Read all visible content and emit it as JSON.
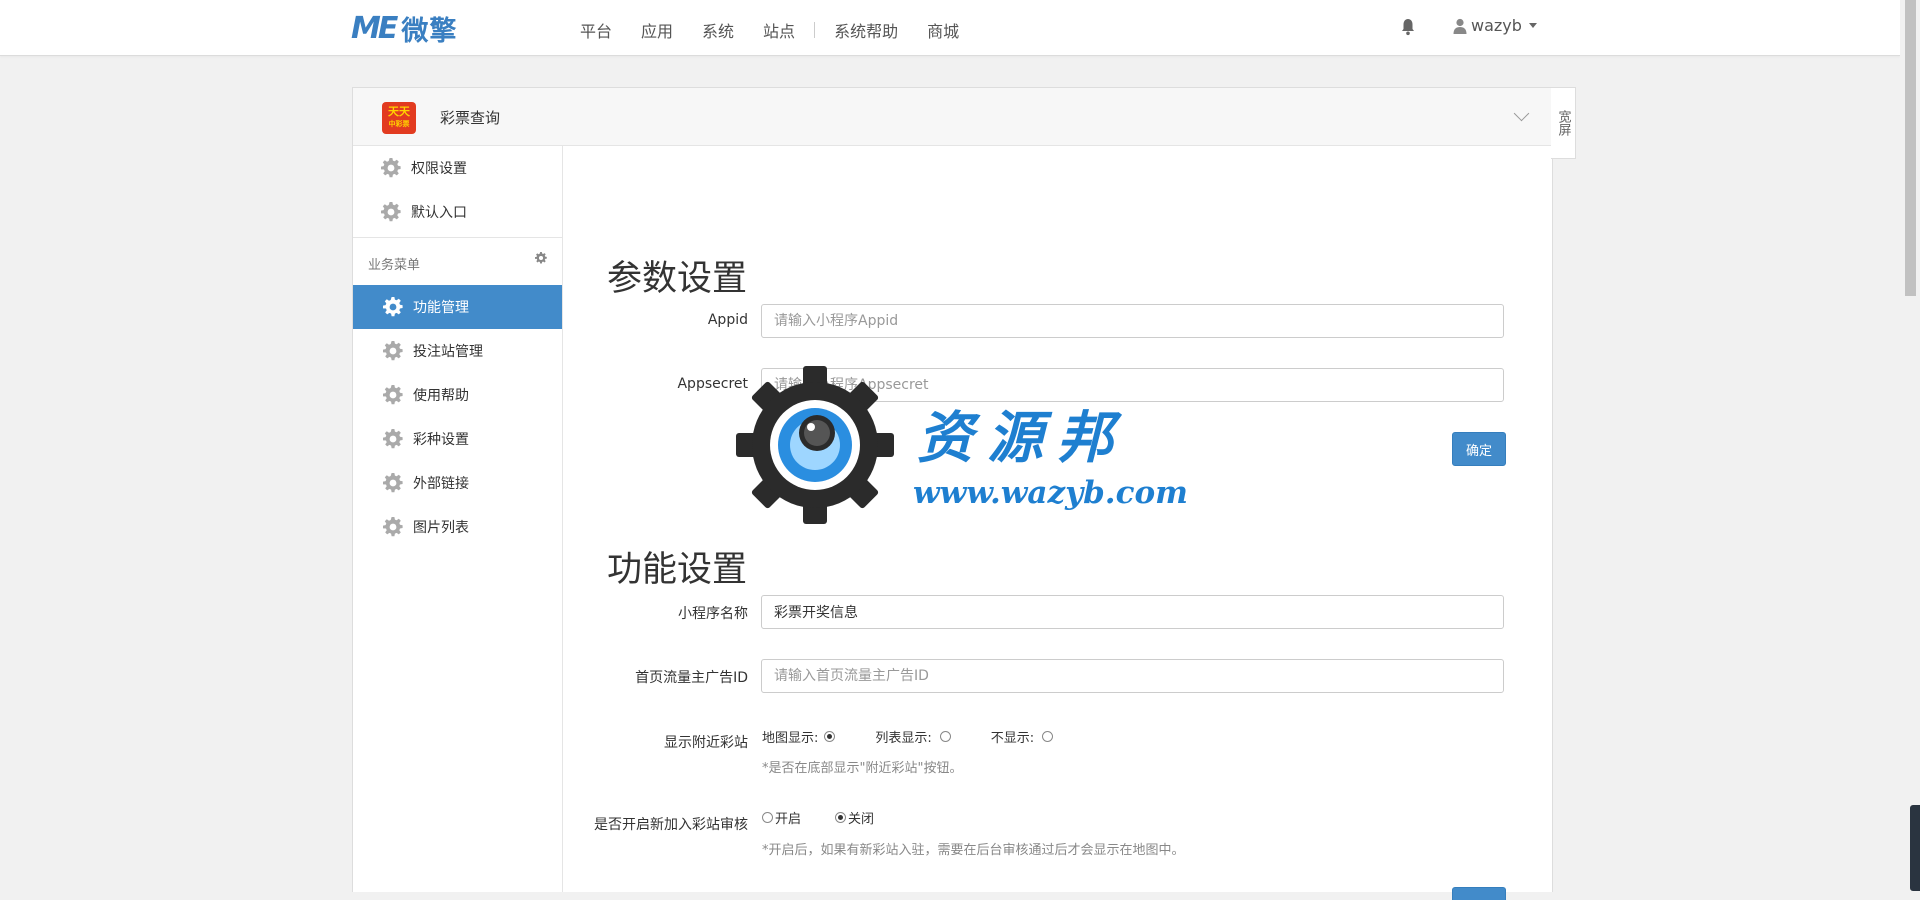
{
  "brand": {
    "logo_mark": "ME",
    "logo_text": "微擎"
  },
  "nav": {
    "items": [
      "平台",
      "应用",
      "系统",
      "站点",
      "系统帮助",
      "商城"
    ]
  },
  "user": {
    "name": "wazyb"
  },
  "app": {
    "title": "彩票查询",
    "icon_text_1": "天天",
    "icon_text_2": "中彩票",
    "widescreen_label": "宽屏"
  },
  "sidebar": {
    "top_items": [
      {
        "label": "权限设置"
      },
      {
        "label": "默认入口"
      }
    ],
    "group_label": "业务菜单",
    "items": [
      {
        "label": "功能管理",
        "active": true
      },
      {
        "label": "投注站管理"
      },
      {
        "label": "使用帮助"
      },
      {
        "label": "彩种设置"
      },
      {
        "label": "外部链接"
      },
      {
        "label": "图片列表"
      }
    ]
  },
  "params": {
    "heading": "参数设置",
    "appid_label": "Appid",
    "appid_placeholder": "请输入小程序Appid",
    "appsecret_label": "Appsecret",
    "appsecret_placeholder": "请输入小程序Appsecret",
    "confirm_label": "确定"
  },
  "features": {
    "heading": "功能设置",
    "name_label": "小程序名称",
    "name_value": "彩票开奖信息",
    "ad_label": "首页流量主广告ID",
    "ad_placeholder": "请输入首页流量主广告ID",
    "nearby_label": "显示附近彩站",
    "nearby_options": [
      "地图显示:",
      "列表显示:",
      "不显示:"
    ],
    "nearby_selected": 0,
    "nearby_help": "*是否在底部显示\"附近彩站\"按钮。",
    "review_label": "是否开启新加入彩站审核",
    "review_options": [
      "开启",
      "关闭"
    ],
    "review_selected": 1,
    "review_help": "*开启后，如果有新彩站入驻，需要在后台审核通过后才会显示在地图中。"
  },
  "watermark": {
    "title": "资源邦",
    "url": "www.wazyb.com"
  },
  "colors": {
    "primary": "#428bca",
    "brand": "#3a7fc1",
    "watermark_blue": "#1e7fd0"
  }
}
